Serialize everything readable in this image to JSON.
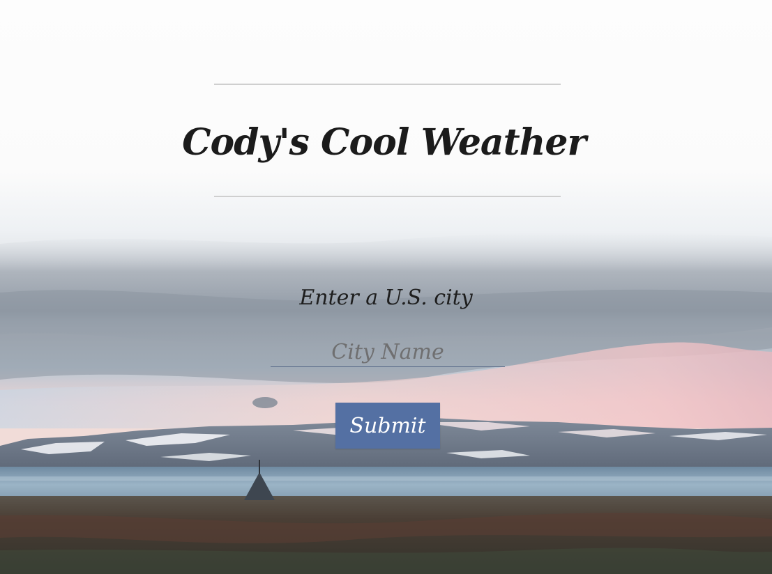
{
  "header": {
    "title": "Cody's Cool Weather",
    "icon": "globe-americas-icon"
  },
  "form": {
    "prompt": "Enter a U.S. city",
    "city_placeholder": "City Name",
    "city_value": "",
    "submit_label": "Submit"
  },
  "theme": {
    "button_color": "#5470a3",
    "text_color": "#1b1b1b"
  }
}
